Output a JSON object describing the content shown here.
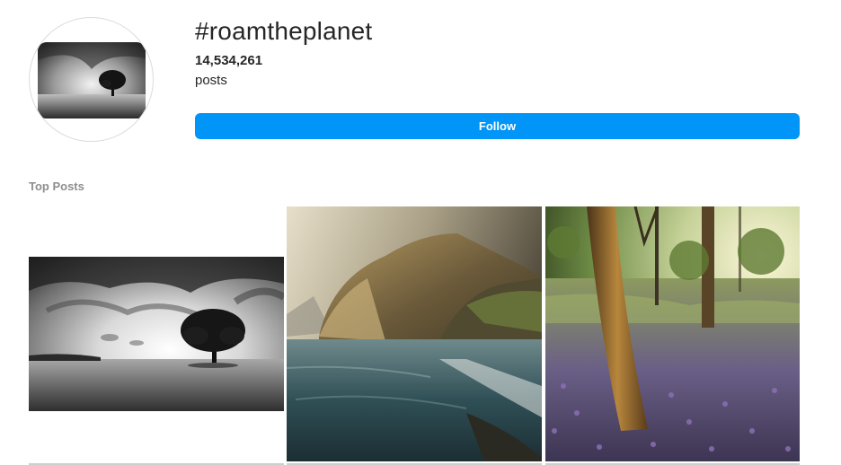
{
  "header": {
    "hashtag": "#roamtheplanet",
    "post_count": "14,534,261",
    "post_count_label": "posts",
    "follow_label": "Follow",
    "avatar_icon": "hashtag-avatar-image"
  },
  "top_posts": {
    "title": "Top Posts",
    "items": [
      {
        "icon": "black-and-white-tree-photo"
      },
      {
        "icon": "coastal-cliff-sea-photo"
      },
      {
        "icon": "forest-bluebell-trees-photo"
      }
    ]
  },
  "colors": {
    "follow_button": "#0095f6",
    "text_primary": "#262626",
    "text_secondary": "#8e8e8e"
  }
}
